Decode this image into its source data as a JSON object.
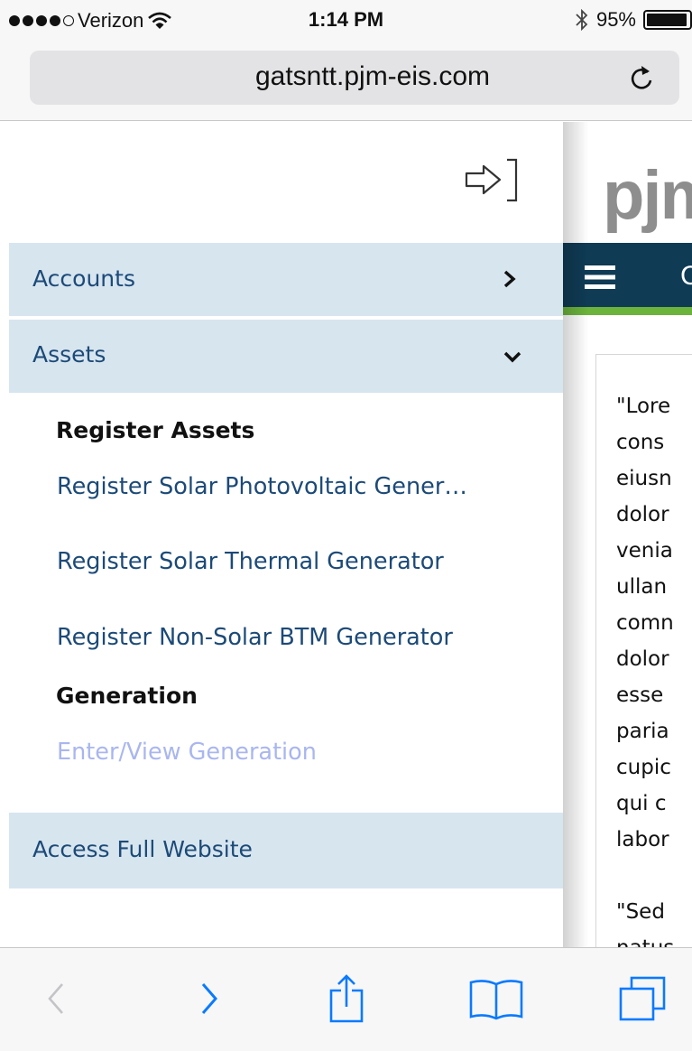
{
  "status_bar": {
    "carrier": "Verizon",
    "time": "1:14 PM",
    "battery": "95%",
    "battery_level": 0.95,
    "icons": [
      "signal-dots",
      "wifi-icon",
      "bluetooth-icon",
      "battery-icon"
    ]
  },
  "browser": {
    "url": "gatsntt.pjm-eis.com",
    "reload_icon": "reload-icon"
  },
  "menu": {
    "collapse_icon": "collapse-menu-icon",
    "accounts": {
      "label": "Accounts",
      "chevron": ">"
    },
    "assets": {
      "label": "Assets",
      "chevron": "⌄"
    },
    "register_heading": "Register Assets",
    "register_links": [
      "Register Solar Photovoltaic Gener…",
      "Register Solar Thermal Generator",
      "Register Non-Solar BTM Generator"
    ],
    "generation_heading": "Generation",
    "generation_link": "Enter/View Generation",
    "full_site": "Access Full Website"
  },
  "background_page": {
    "logo": "pjm",
    "nav_letter": "C",
    "content_lines": [
      "\"Lore",
      "cons",
      "eiusn",
      "dolor",
      "venia",
      "ullan",
      "comn",
      "dolor",
      "esse",
      "paria",
      "cupic",
      "qui c",
      "labor",
      "",
      "\"Sed",
      "natus"
    ]
  },
  "toolbar": {
    "icons": [
      "back-icon",
      "forward-icon",
      "share-icon",
      "bookmarks-icon",
      "tabs-icon"
    ]
  },
  "colors": {
    "menu_bg": "#d7e5ef",
    "menu_text": "#1c4a78",
    "disabled_link": "#a9b6ef",
    "navbar": "#0f3b55",
    "navbar_accent": "#6bb33a",
    "ios_blue": "#0a7aff"
  }
}
